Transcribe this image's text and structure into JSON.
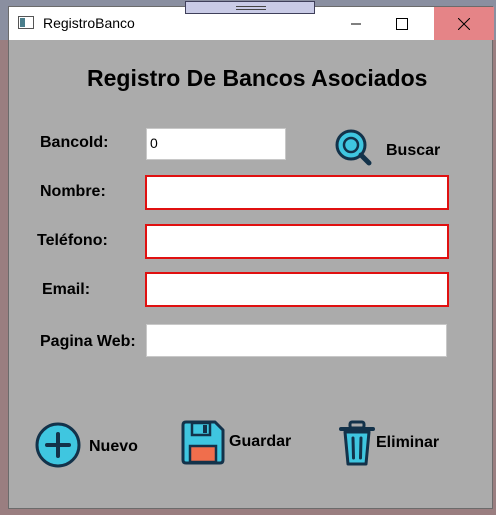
{
  "window": {
    "title": "RegistroBanco"
  },
  "form": {
    "heading": "Registro De Bancos Asociados",
    "fields": [
      {
        "label": "BancoId:",
        "value": "0",
        "placeholder": ""
      },
      {
        "label": "Nombre:",
        "value": "",
        "placeholder": ""
      },
      {
        "label": "Teléfono:",
        "value": "",
        "placeholder": ""
      },
      {
        "label": "Email:",
        "value": "",
        "placeholder": ""
      },
      {
        "label": "Pagina Web:",
        "value": "",
        "placeholder": ""
      }
    ]
  },
  "actions": {
    "search_label": "Buscar",
    "new_label": "Nuevo",
    "save_label": "Guardar",
    "delete_label": "Eliminar"
  },
  "icons": {
    "search": "search-icon",
    "new": "plus-circle-icon",
    "save": "floppy-disk-icon",
    "delete": "trash-icon"
  },
  "colors": {
    "accent": "#3fc6e0",
    "error_border": "#e01010",
    "close_hover": "#e58487"
  }
}
